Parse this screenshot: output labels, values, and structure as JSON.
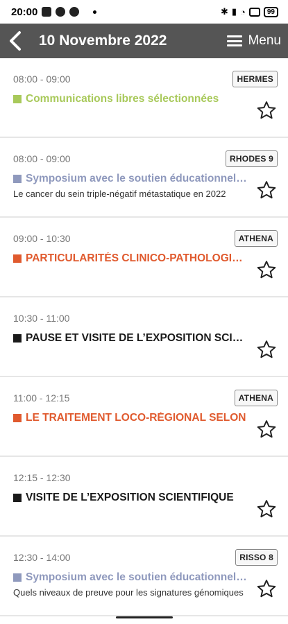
{
  "status_bar": {
    "time": "20:00",
    "battery": "99"
  },
  "header": {
    "title": "10 Novembre 2022",
    "menu_label": "Menu"
  },
  "sessions": [
    {
      "time": "08:00 - 09:00",
      "room": "HERMES",
      "title": "Communications libres sélectionnées",
      "subtitle": "",
      "color": "#a8c95a"
    },
    {
      "time": "08:00 - 09:00",
      "room": "RHODES 9",
      "title": "Symposium avec le soutien éducationnel de",
      "subtitle": "Le cancer du sein triple-négatif métastatique en 2022",
      "color": "#8f99bd"
    },
    {
      "time": "09:00 - 10:30",
      "room": "ATHENA",
      "title": "PARTICULARITÉS CLINICO-PATHOLOGIQUES",
      "subtitle": "",
      "color": "#e05a2e"
    },
    {
      "time": "10:30 - 11:00",
      "room": "",
      "title": "PAUSE ET VISITE DE L’EXPOSITION SCIENTIFIQUE",
      "subtitle": "",
      "color": "#1a1a1a"
    },
    {
      "time": "11:00 - 12:15",
      "room": "ATHENA",
      "title": "LE TRAITEMENT LOCO-RÉGIONAL SELON",
      "subtitle": "",
      "color": "#e05a2e"
    },
    {
      "time": "12:15 - 12:30",
      "room": "",
      "title": "VISITE DE L’EXPOSITION SCIENTIFIQUE",
      "subtitle": "",
      "color": "#1a1a1a"
    },
    {
      "time": "12:30 - 14:00",
      "room": "RISSO 8",
      "title": "Symposium avec le soutien éducationnel de",
      "subtitle": "Quels niveaux de preuve pour les signatures génomiques",
      "color": "#8f99bd"
    }
  ]
}
